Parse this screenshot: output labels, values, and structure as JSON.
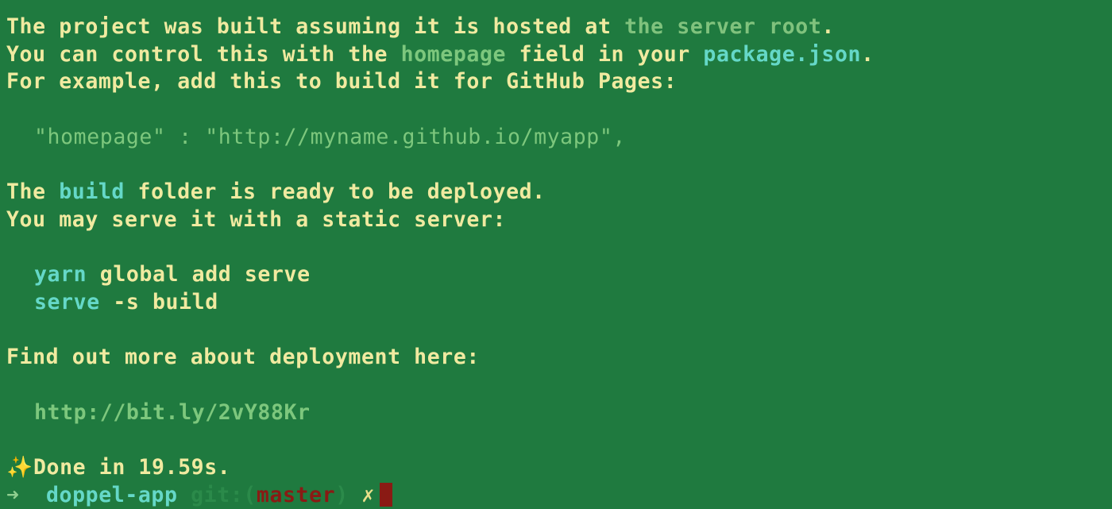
{
  "output": {
    "l1_pre": "The project was built assuming it is hosted at ",
    "l1_hl": "the server root",
    "l1_post": ".",
    "l2_pre": "You can control this with the ",
    "l2_hl1": "homepage",
    "l2_mid": " field in your ",
    "l2_hl2": "package.json",
    "l2_post": ".",
    "l3": "For example, add this to build it for GitHub Pages:",
    "l4_code": "\"homepage\" : \"http://myname.github.io/myapp\",",
    "l5_pre": "The ",
    "l5_hl": "build",
    "l5_post": " folder is ready to be deployed.",
    "l6": "You may serve it with a static server:",
    "l7_cmd": "yarn",
    "l7_rest": " global add serve",
    "l8_cmd": "serve",
    "l8_rest": " -s build",
    "l9": "Find out more about deployment here:",
    "l10_url": "http://bit.ly/2vY88Kr",
    "done": "Done in 19.59s."
  },
  "icons": {
    "sparkle": "sparkles-icon",
    "arrow": "right-arrow-icon",
    "dirty": "x-mark-icon"
  },
  "prompt": {
    "arrow_glyph": "➜",
    "directory": "doppel-app",
    "git_label": "git:(",
    "branch": "master",
    "git_close": ")",
    "dirty_glyph": "✗"
  },
  "colors": {
    "background": "#1f7a3f",
    "text": "#f0eaa0",
    "cyan": "#65d8c8",
    "green": "#7dc77d",
    "branch_red": "#8a1a14"
  }
}
